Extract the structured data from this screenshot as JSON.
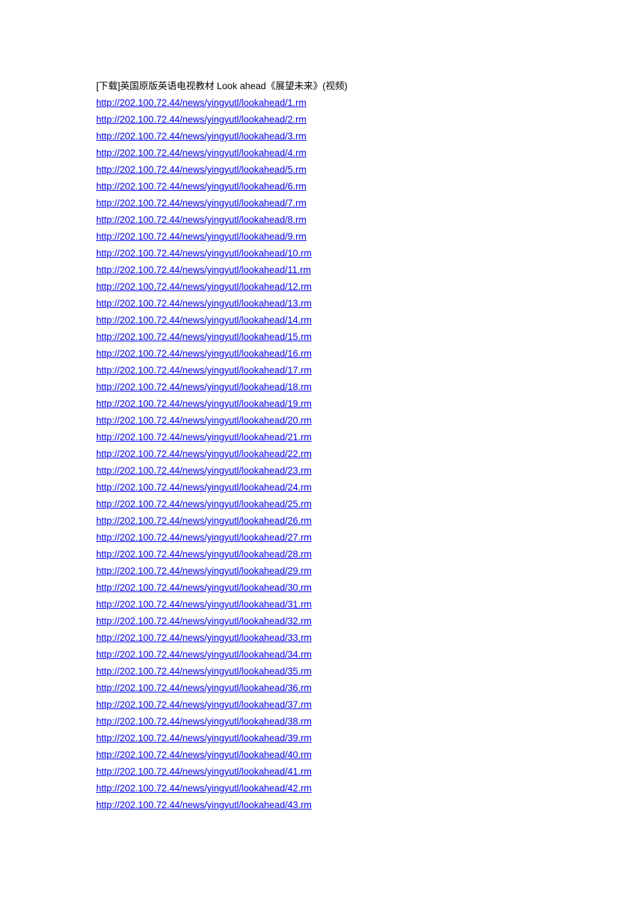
{
  "document": {
    "background_color": "#ffffff",
    "text_color": "#000000",
    "link_color": "#0000ee",
    "title": "[下载]英国原版英语电视教材 Look ahead《展望未来》(视频)",
    "links": [
      {
        "text": "http://202.100.72.44/news/yingyutl/lookahead/1.rm"
      },
      {
        "text": "http://202.100.72.44/news/yingyutl/lookahead/2.rm"
      },
      {
        "text": "http://202.100.72.44/news/yingyutl/lookahead/3.rm"
      },
      {
        "text": "http://202.100.72.44/news/yingyutl/lookahead/4.rm"
      },
      {
        "text": "http://202.100.72.44/news/yingyutl/lookahead/5.rm"
      },
      {
        "text": "http://202.100.72.44/news/yingyutl/lookahead/6.rm"
      },
      {
        "text": "http://202.100.72.44/news/yingyutl/lookahead/7.rm"
      },
      {
        "text": "http://202.100.72.44/news/yingyutl/lookahead/8.rm"
      },
      {
        "text": "http://202.100.72.44/news/yingyutl/lookahead/9.rm"
      },
      {
        "text": "http://202.100.72.44/news/yingyutl/lookahead/10.rm"
      },
      {
        "text": "http://202.100.72.44/news/yingyutl/lookahead/11.rm"
      },
      {
        "text": "http://202.100.72.44/news/yingyutl/lookahead/12.rm"
      },
      {
        "text": "http://202.100.72.44/news/yingyutl/lookahead/13.rm"
      },
      {
        "text": "http://202.100.72.44/news/yingyutl/lookahead/14.rm"
      },
      {
        "text": "http://202.100.72.44/news/yingyutl/lookahead/15.rm"
      },
      {
        "text": "http://202.100.72.44/news/yingyutl/lookahead/16.rm"
      },
      {
        "text": "http://202.100.72.44/news/yingyutl/lookahead/17.rm"
      },
      {
        "text": "http://202.100.72.44/news/yingyutl/lookahead/18.rm"
      },
      {
        "text": "http://202.100.72.44/news/yingyutl/lookahead/19.rm"
      },
      {
        "text": "http://202.100.72.44/news/yingyutl/lookahead/20.rm"
      },
      {
        "text": "http://202.100.72.44/news/yingyutl/lookahead/21.rm"
      },
      {
        "text": "http://202.100.72.44/news/yingyutl/lookahead/22.rm"
      },
      {
        "text": "http://202.100.72.44/news/yingyutl/lookahead/23.rm"
      },
      {
        "text": "http://202.100.72.44/news/yingyutl/lookahead/24.rm"
      },
      {
        "text": "http://202.100.72.44/news/yingyutl/lookahead/25.rm"
      },
      {
        "text": "http://202.100.72.44/news/yingyutl/lookahead/26.rm"
      },
      {
        "text": "http://202.100.72.44/news/yingyutl/lookahead/27.rm"
      },
      {
        "text": "http://202.100.72.44/news/yingyutl/lookahead/28.rm"
      },
      {
        "text": "http://202.100.72.44/news/yingyutl/lookahead/29.rm"
      },
      {
        "text": "http://202.100.72.44/news/yingyutl/lookahead/30.rm"
      },
      {
        "text": "http://202.100.72.44/news/yingyutl/lookahead/31.rm"
      },
      {
        "text": "http://202.100.72.44/news/yingyutl/lookahead/32.rm"
      },
      {
        "text": "http://202.100.72.44/news/yingyutl/lookahead/33.rm"
      },
      {
        "text": "http://202.100.72.44/news/yingyutl/lookahead/34.rm"
      },
      {
        "text": "http://202.100.72.44/news/yingyutl/lookahead/35.rm"
      },
      {
        "text": "http://202.100.72.44/news/yingyutl/lookahead/36.rm"
      },
      {
        "text": "http://202.100.72.44/news/yingyutl/lookahead/37.rm"
      },
      {
        "text": "http://202.100.72.44/news/yingyutl/lookahead/38.rm"
      },
      {
        "text": "http://202.100.72.44/news/yingyutl/lookahead/39.rm"
      },
      {
        "text": "http://202.100.72.44/news/yingyutl/lookahead/40.rm"
      },
      {
        "text": "http://202.100.72.44/news/yingyutl/lookahead/41.rm"
      },
      {
        "text": "http://202.100.72.44/news/yingyutl/lookahead/42.rm"
      },
      {
        "text": "http://202.100.72.44/news/yingyutl/lookahead/43.rm"
      }
    ]
  }
}
